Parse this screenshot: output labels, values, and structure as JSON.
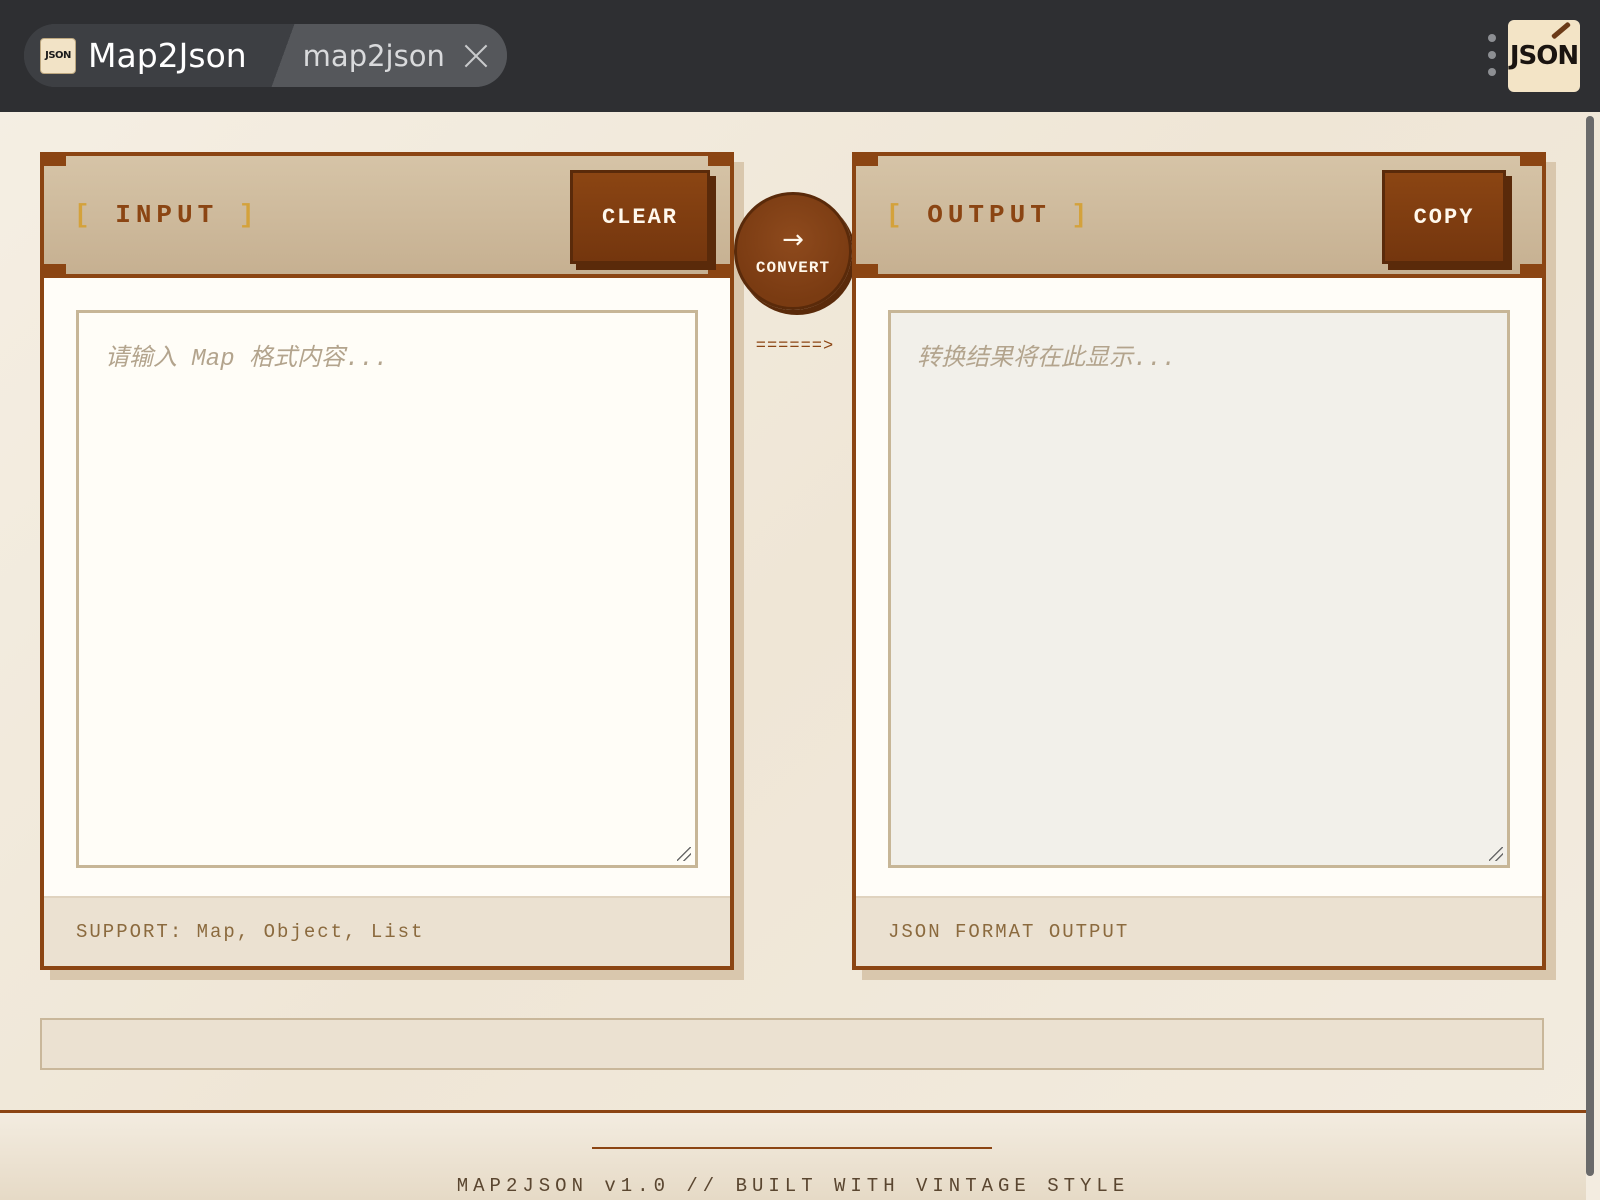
{
  "topbar": {
    "app_icon_text": "JSON",
    "app_title": "Map2Json",
    "second_tab": "map2json",
    "brand_logo_text": "JSON"
  },
  "input_panel": {
    "label": "INPUT",
    "bracket_open": "[",
    "bracket_close": "]",
    "clear_label": "CLEAR",
    "placeholder": "请输入 Map 格式内容...",
    "footer": "SUPPORT: Map, Object, List"
  },
  "output_panel": {
    "label": "OUTPUT",
    "bracket_open": "[",
    "bracket_close": "]",
    "copy_label": "COPY",
    "placeholder": "转换结果将在此显示...",
    "footer": "JSON FORMAT OUTPUT"
  },
  "convert": {
    "arrow": "→",
    "label": "CONVERT",
    "flow_arrow": "======>"
  },
  "footer": {
    "text": "MAP2JSON v1.0 // BUILT WITH VINTAGE STYLE"
  },
  "colors": {
    "accent": "#8b4513",
    "bracket": "#d4a23b",
    "topbar": "#2e2f32",
    "panel_head": "#c6b091"
  }
}
